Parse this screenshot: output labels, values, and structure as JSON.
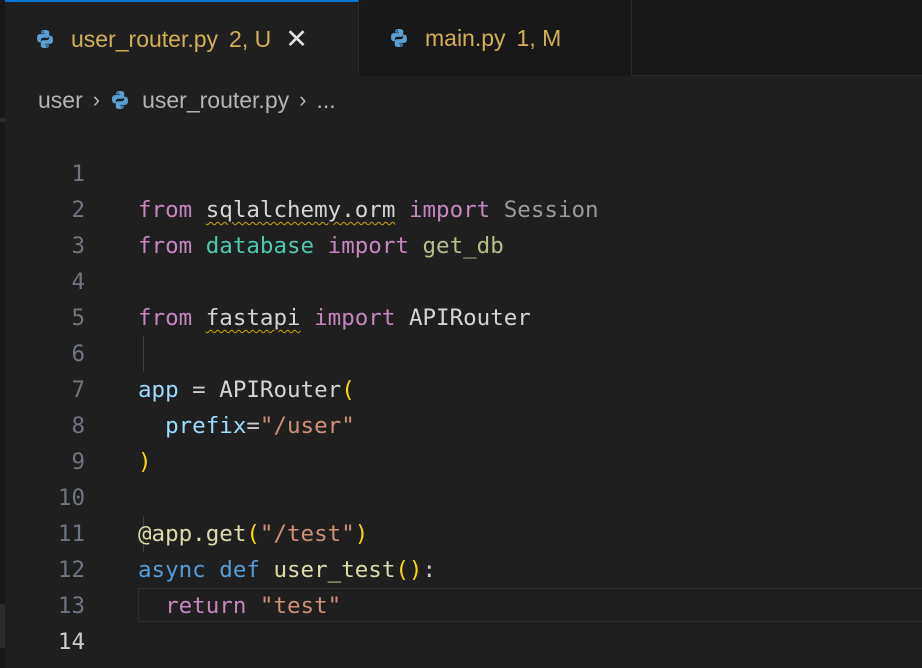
{
  "tabs": [
    {
      "name": "user_router.py",
      "status": "2, U",
      "active": true,
      "close": "✕"
    },
    {
      "name": "main.py",
      "status": "1, M",
      "active": false
    }
  ],
  "breadcrumb": {
    "folder": "user",
    "file": "user_router.py",
    "more": "..."
  },
  "editor": {
    "current_line": 14,
    "line_numbers": [
      "1",
      "2",
      "3",
      "4",
      "5",
      "6",
      "7",
      "8",
      "9",
      "10",
      "11",
      "12",
      "13",
      "14"
    ],
    "lines": {
      "l1": [
        "from",
        " ",
        "sqlalchemy.orm",
        " ",
        "import",
        " ",
        "Session"
      ],
      "l2": [
        "from",
        " ",
        "database",
        " ",
        "import",
        " ",
        "get_db"
      ],
      "l4": [
        "from",
        " ",
        "fastapi",
        " ",
        "import",
        " ",
        "APIRouter"
      ],
      "l6": [
        "app",
        " = ",
        "APIRouter",
        "("
      ],
      "l7": [
        "  ",
        "prefix",
        "=",
        "\"/user\""
      ],
      "l8": [
        ")"
      ],
      "l10": [
        "@app.get",
        "(",
        "\"/test\"",
        ")"
      ],
      "l11": [
        "async",
        " ",
        "def",
        " ",
        "user_test",
        "()",
        ":"
      ],
      "l12": [
        "  ",
        "return",
        " ",
        "\"test\""
      ]
    }
  },
  "colors": {
    "accent": "#0078d4",
    "tab_modified": "#d3b055",
    "keyword_import": "#c586c0",
    "keyword": "#569cd6",
    "function": "#dcdcaa",
    "string": "#ce9178",
    "variable": "#9cdcfe"
  },
  "icons": {
    "python": "python-file-icon",
    "chevron": "chevron-right-icon",
    "close": "close-icon"
  }
}
